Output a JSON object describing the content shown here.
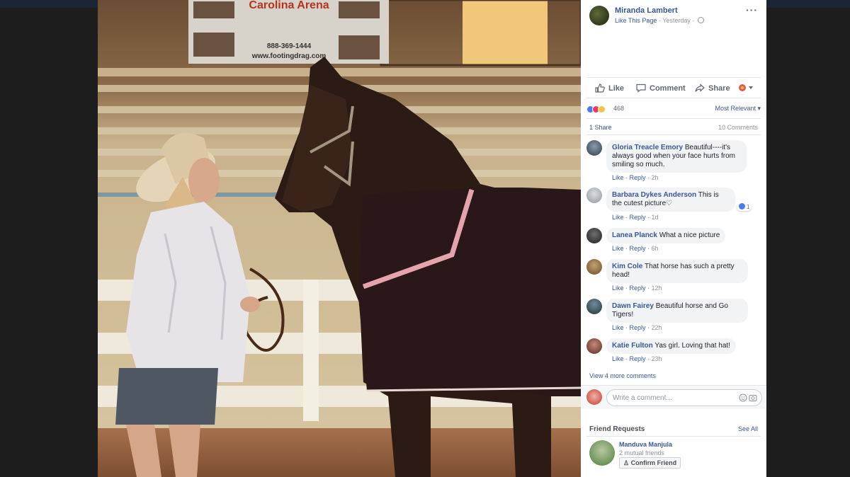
{
  "post": {
    "author": "Miranda Lambert",
    "like_page": "Like This Page",
    "separator": " · ",
    "time": "Yesterday",
    "more": "···"
  },
  "photo": {
    "sign_title": "Carolina Arena",
    "sign_phone": "888-369-1444",
    "sign_url": "www.footingdrag.com"
  },
  "actions": {
    "like": "Like",
    "comment": "Comment",
    "share": "Share"
  },
  "reactions": {
    "count": "468",
    "sort": "Most Relevant ▾"
  },
  "stats": {
    "shares": "1 Share",
    "comments": "10 Comments"
  },
  "comments": [
    {
      "name": "Gloria Treacle Emory",
      "text": "Beautiful----it's always good when your face hurts from smiling so much.",
      "like": "Like",
      "reply": "Reply",
      "time": "2h"
    },
    {
      "name": "Barbara Dykes Anderson",
      "text": "This is the cutest picture♡",
      "like": "Like",
      "reply": "Reply",
      "time": "1d",
      "reaction_count": "1"
    },
    {
      "name": "Lanea Planck",
      "text": "What a nice picture",
      "like": "Like",
      "reply": "Reply",
      "time": "6h"
    },
    {
      "name": "Kim Cole",
      "text": "That horse has such a pretty head!",
      "like": "Like",
      "reply": "Reply",
      "time": "12h"
    },
    {
      "name": "Dawn Fairey",
      "text": "Beautiful horse and Go Tigers!",
      "like": "Like",
      "reply": "Reply",
      "time": "22h"
    },
    {
      "name": "Katie Fulton",
      "text": "Yas girl. Loving that hat!",
      "like": "Like",
      "reply": "Reply",
      "time": "23h"
    }
  ],
  "view_more": "View 4 more comments",
  "write_comment": {
    "placeholder": "Write a comment..."
  },
  "friend_requests": {
    "title": "Friend Requests",
    "see_all": "See All",
    "name": "Manduva Manjula",
    "mutual": "2 mutual friends",
    "confirm": "Confirm Friend"
  },
  "colors": {
    "link": "#385898",
    "meta": "#90949c",
    "bubble": "#f2f3f5",
    "topbar": "#1a2433"
  },
  "icons": {
    "like": "thumbs-up-icon",
    "comment": "speech-bubble-icon",
    "share": "share-arrow-icon",
    "globe": "globe-icon",
    "emoji": "emoji-icon",
    "camera": "camera-icon"
  }
}
